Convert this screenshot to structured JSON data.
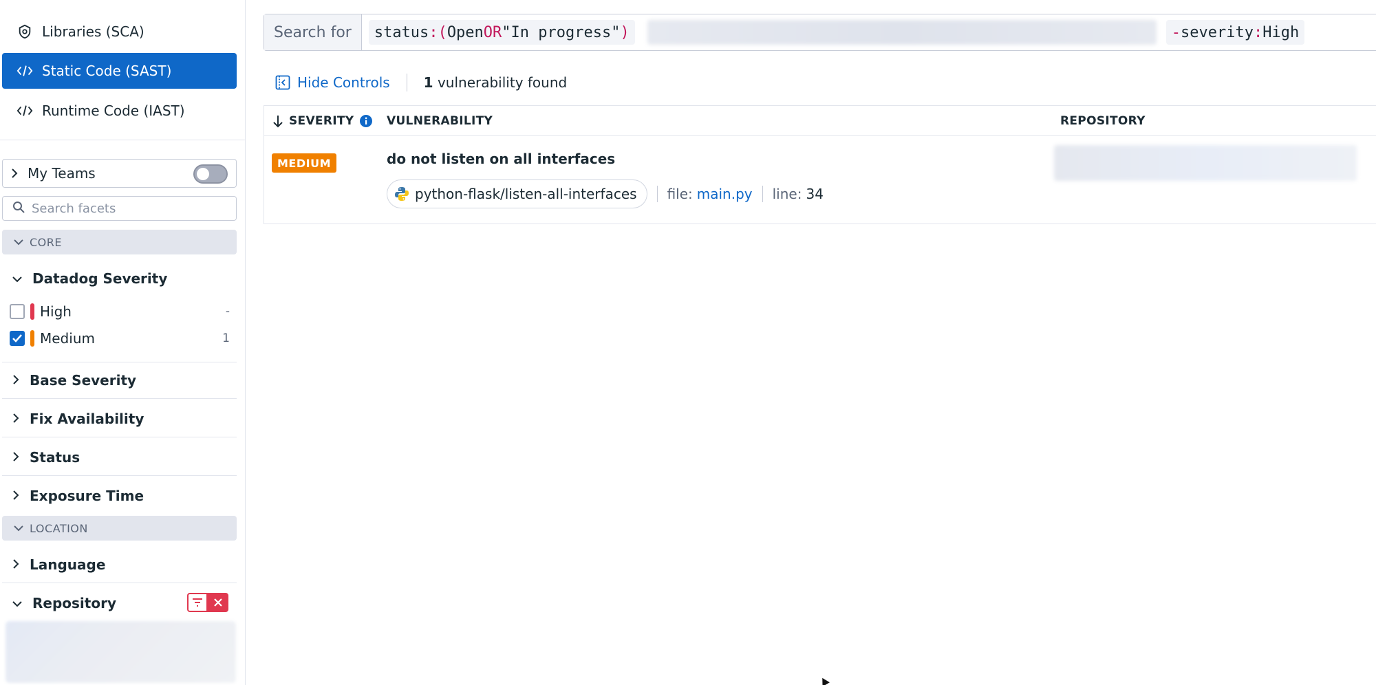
{
  "sidebar": {
    "nav": [
      {
        "label": "Libraries (SCA)",
        "icon": "shield-icon",
        "active": false
      },
      {
        "label": "Static Code (SAST)",
        "icon": "code-icon",
        "active": true
      },
      {
        "label": "Runtime Code (IAST)",
        "icon": "code-icon",
        "active": false
      }
    ],
    "my_teams": {
      "label": "My Teams",
      "toggle_on": false
    },
    "facet_search": {
      "placeholder": "Search facets"
    },
    "sections": {
      "core": "CORE",
      "location": "LOCATION"
    },
    "facets": {
      "datadog_severity": {
        "label": "Datadog Severity",
        "options": [
          {
            "label": "High",
            "count": "-",
            "checked": false,
            "color": "#e0384f"
          },
          {
            "label": "Medium",
            "count": "1",
            "checked": true,
            "color": "#f08000"
          }
        ]
      },
      "base_severity": "Base Severity",
      "fix_availability": "Fix Availability",
      "status": "Status",
      "exposure_time": "Exposure Time",
      "language": "Language",
      "repository": "Repository"
    }
  },
  "search": {
    "label": "Search for",
    "query": {
      "key": "status",
      "colon": ":",
      "open_paren": "(",
      "value1": "Open",
      "bool": "OR",
      "value2": "\"In progress\"",
      "close_paren": ")",
      "neg": "-",
      "key2": "severity",
      "colon2": ":",
      "value3": "High"
    }
  },
  "controls": {
    "hide_label": "Hide Controls",
    "count": "1",
    "count_suffix": "vulnerability found"
  },
  "table": {
    "columns": {
      "severity": "SEVERITY",
      "vulnerability": "VULNERABILITY",
      "repository": "REPOSITORY"
    },
    "rows": [
      {
        "severity": "MEDIUM",
        "severity_color": "#f08000",
        "title": "do not listen on all interfaces",
        "rule": "python-flask/listen-all-interfaces",
        "file_label": "file:",
        "file": "main.py",
        "line_label": "line:",
        "line": "34"
      }
    ]
  },
  "colors": {
    "accent": "#0f68c8",
    "high": "#e0384f",
    "medium": "#f08000"
  }
}
